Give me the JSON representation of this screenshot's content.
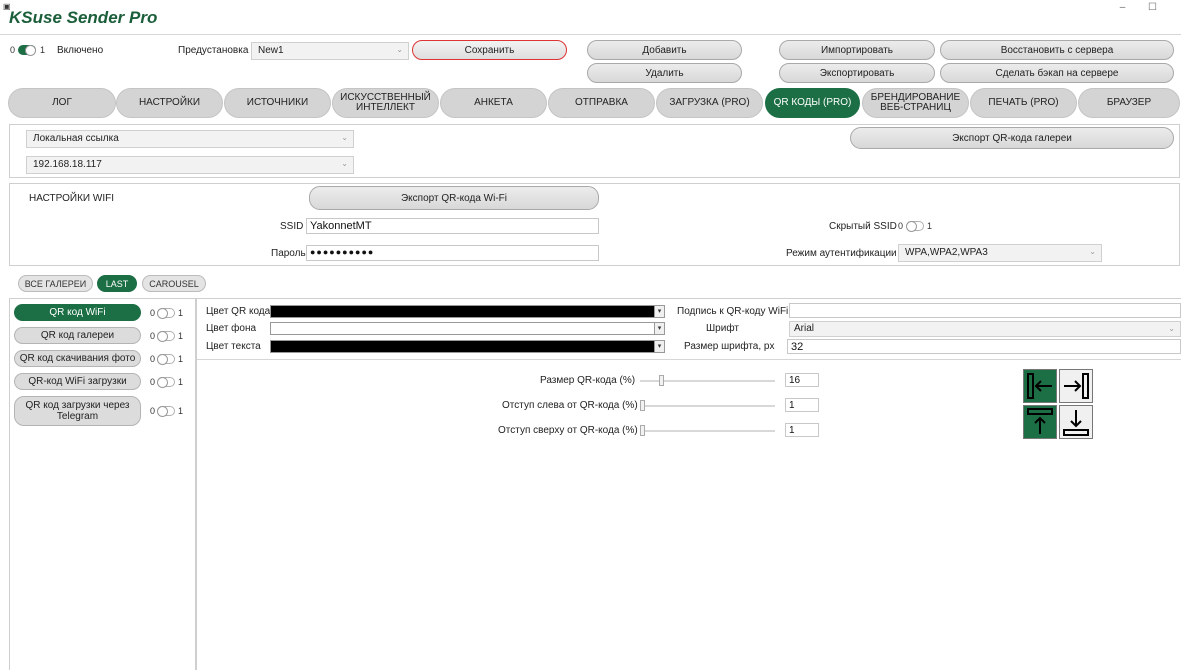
{
  "app": {
    "icon": "app-icon",
    "title": "KSuse Sender Pro",
    "window_controls": "– ☐"
  },
  "top": {
    "toggle_left": "0",
    "toggle_right": "1",
    "enabled_label": "Включено",
    "preset_label": "Предустановка",
    "preset_value": "New1",
    "save": "Сохранить",
    "add": "Добавить",
    "delete": "Удалить",
    "import": "Импортировать",
    "export": "Экспортировать",
    "restore": "Восстановить с сервера",
    "backup": "Сделать бэкап на сервере"
  },
  "tabs": [
    "ЛОГ",
    "НАСТРОЙКИ",
    "ИСТОЧНИКИ",
    "ИСКУССТВЕННЫЙ ИНТЕЛЛЕКТ",
    "АНКЕТА",
    "ОТПРАВКА",
    "ЗАГРУЗКА (PRO)",
    "QR КОДЫ (PRO)",
    "БРЕНДИРОВАНИЕ ВЕБ-СТРАНИЦ",
    "ПЕЧАТЬ (PRO)",
    "БРАУЗЕР"
  ],
  "active_tab": "QR КОДЫ (PRO)",
  "link": {
    "link_type": "Локальная ссылка",
    "ip": "192.168.18.117",
    "export_gallery": "Экспорт QR-кода галереи"
  },
  "wifi": {
    "heading": "НАСТРОЙКИ WIFI",
    "export": "Экспорт QR-кода Wi-Fi",
    "ssid_label": "SSID",
    "ssid_value": "YakonnetMT",
    "password_label": "Пароль",
    "password_value": "●●●●●●●●●●",
    "hidden_label": "Скрытый SSID",
    "hidden_left": "0",
    "hidden_right": "1",
    "auth_label": "Режим аутентификации",
    "auth_value": "WPA,WPA2,WPA3"
  },
  "gallery_tabs": [
    "ВСЕ ГАЛЕРЕИ",
    "LAST",
    "CAROUSEL"
  ],
  "side": [
    {
      "label": "QR код WiFi",
      "a": "0",
      "b": "1"
    },
    {
      "label": "QR код галереи",
      "a": "0",
      "b": "1"
    },
    {
      "label": "QR код скачивания фото",
      "a": "0",
      "b": "1"
    },
    {
      "label": "QR-код WiFi загрузки",
      "a": "0",
      "b": "1"
    },
    {
      "label": "QR код загрузки через Telegram",
      "a": "0",
      "b": "1"
    }
  ],
  "settings": {
    "qr_color": "Цвет QR кода",
    "bg_color": "Цвет фона",
    "text_color": "Цвет текста",
    "caption_label": "Подпись к QR-коду WiFi",
    "caption_value": "",
    "font_label": "Шрифт",
    "font_value": "Arial",
    "font_size_label": "Размер шрифта, px",
    "font_size_value": "32",
    "qr_size_label": "Размер QR-кода (%)",
    "qr_size_value": "16",
    "left_label": "Отступ слева от QR-кода (%)",
    "left_value": "1",
    "top_label": "Отступ сверху от QR-кода (%)",
    "top_value": "1"
  },
  "colors": {
    "accent": "#1c6e45",
    "qr_color": "#000000",
    "bg_color": "#ffffff",
    "text_color": "#000000"
  }
}
